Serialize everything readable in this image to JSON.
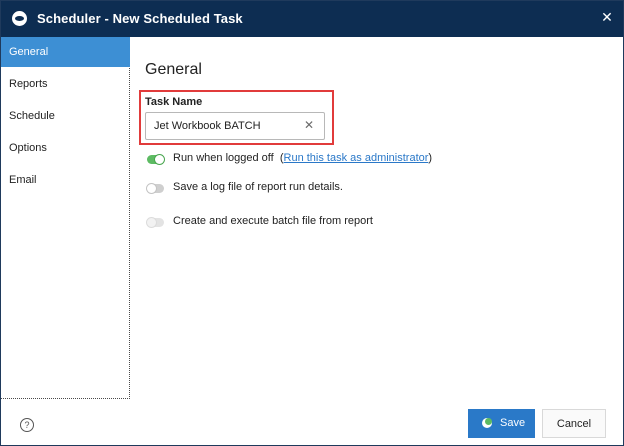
{
  "window": {
    "title": "Scheduler - New Scheduled Task",
    "app_icon": "scheduler-icon",
    "close_glyph": "✕"
  },
  "sidebar": {
    "items": [
      {
        "label": "General",
        "active": true
      },
      {
        "label": "Reports",
        "active": false
      },
      {
        "label": "Schedule",
        "active": false
      },
      {
        "label": "Options",
        "active": false
      },
      {
        "label": "Email",
        "active": false
      }
    ]
  },
  "main": {
    "section_title": "General",
    "task_name": {
      "label": "Task Name",
      "value": "Jet Workbook BATCH",
      "clear_glyph": "✕"
    },
    "options": [
      {
        "label": "Run when logged off",
        "link_prefix": "(",
        "link": "Run this task as administrator",
        "link_suffix": ")",
        "state": "on"
      },
      {
        "label": "Save a log file of report run details.",
        "state": "off"
      },
      {
        "label": "Create and execute batch file from report",
        "state": "disabled"
      }
    ]
  },
  "footer": {
    "help_glyph": "?",
    "save_label": "Save",
    "cancel_label": "Cancel"
  },
  "colors": {
    "titlebar": "#0d2d52",
    "sidebar_active": "#3d8fd4",
    "toggle_on": "#5dbb63",
    "primary_button": "#2a79c8",
    "highlight_border": "#e13b3b",
    "link": "#2a78c8"
  }
}
